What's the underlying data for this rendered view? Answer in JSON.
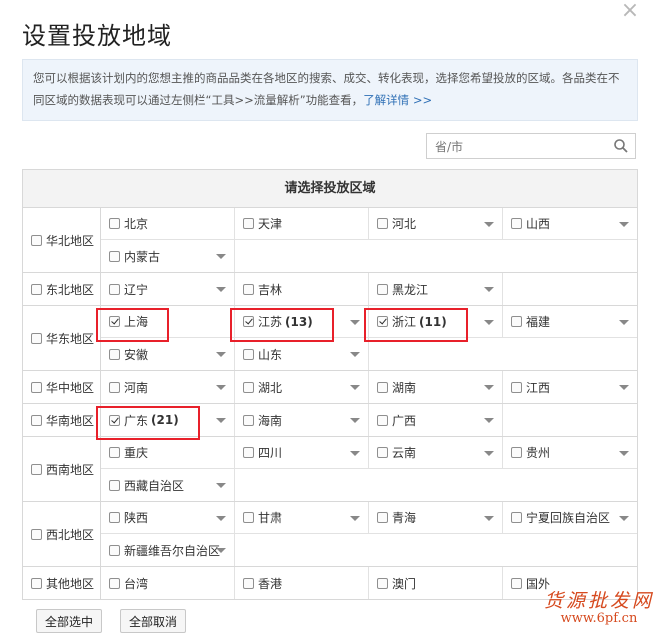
{
  "dialog": {
    "title": "设置投放地域",
    "close": "×",
    "info_text": "您可以根据该计划内的您想主推的商品品类在各地区的搜索、成交、转化表现，选择您希望投放的区域。各品类在不同区域的数据表现可以通过左侧栏“工具>>流量解析”功能查看，",
    "info_link": "了解详情 >>",
    "search_placeholder": "省/市",
    "grid_header": "请选择投放区域",
    "select_all": "全部选中",
    "deselect_all": "全部取消",
    "watermark_line1": "货源批发网",
    "watermark_line2": "www.6pf.cn"
  },
  "regions": [
    {
      "name": "华北地区",
      "checked": false,
      "provinces": [
        {
          "name": "北京",
          "checked": false,
          "count": "",
          "dropdown": false
        },
        {
          "name": "天津",
          "checked": false,
          "count": "",
          "dropdown": false
        },
        {
          "name": "河北",
          "checked": false,
          "count": "",
          "dropdown": true
        },
        {
          "name": "山西",
          "checked": false,
          "count": "",
          "dropdown": true
        },
        {
          "name": "内蒙古",
          "checked": false,
          "count": "",
          "dropdown": true
        }
      ]
    },
    {
      "name": "东北地区",
      "checked": false,
      "provinces": [
        {
          "name": "辽宁",
          "checked": false,
          "count": "",
          "dropdown": true
        },
        {
          "name": "吉林",
          "checked": false,
          "count": "",
          "dropdown": false
        },
        {
          "name": "黑龙江",
          "checked": false,
          "count": "",
          "dropdown": true
        }
      ]
    },
    {
      "name": "华东地区",
      "checked": false,
      "provinces": [
        {
          "name": "上海",
          "checked": true,
          "count": "",
          "dropdown": false
        },
        {
          "name": "江苏",
          "checked": true,
          "count": "(13)",
          "dropdown": true
        },
        {
          "name": "浙江",
          "checked": true,
          "count": "(11)",
          "dropdown": true
        },
        {
          "name": "福建",
          "checked": false,
          "count": "",
          "dropdown": true
        },
        {
          "name": "安徽",
          "checked": false,
          "count": "",
          "dropdown": true
        },
        {
          "name": "山东",
          "checked": false,
          "count": "",
          "dropdown": true
        }
      ]
    },
    {
      "name": "华中地区",
      "checked": false,
      "provinces": [
        {
          "name": "河南",
          "checked": false,
          "count": "",
          "dropdown": true
        },
        {
          "name": "湖北",
          "checked": false,
          "count": "",
          "dropdown": true
        },
        {
          "name": "湖南",
          "checked": false,
          "count": "",
          "dropdown": true
        },
        {
          "name": "江西",
          "checked": false,
          "count": "",
          "dropdown": true
        }
      ]
    },
    {
      "name": "华南地区",
      "checked": false,
      "provinces": [
        {
          "name": "广东",
          "checked": true,
          "count": "(21)",
          "dropdown": true
        },
        {
          "name": "海南",
          "checked": false,
          "count": "",
          "dropdown": true
        },
        {
          "name": "广西",
          "checked": false,
          "count": "",
          "dropdown": true
        }
      ]
    },
    {
      "name": "西南地区",
      "checked": false,
      "provinces": [
        {
          "name": "重庆",
          "checked": false,
          "count": "",
          "dropdown": false
        },
        {
          "name": "四川",
          "checked": false,
          "count": "",
          "dropdown": true
        },
        {
          "name": "云南",
          "checked": false,
          "count": "",
          "dropdown": true
        },
        {
          "name": "贵州",
          "checked": false,
          "count": "",
          "dropdown": true
        },
        {
          "name": "西藏自治区",
          "checked": false,
          "count": "",
          "dropdown": true
        }
      ]
    },
    {
      "name": "西北地区",
      "checked": false,
      "provinces": [
        {
          "name": "陕西",
          "checked": false,
          "count": "",
          "dropdown": true
        },
        {
          "name": "甘肃",
          "checked": false,
          "count": "",
          "dropdown": true
        },
        {
          "name": "青海",
          "checked": false,
          "count": "",
          "dropdown": true
        },
        {
          "name": "宁夏回族自治区",
          "checked": false,
          "count": "",
          "dropdown": true
        },
        {
          "name": "新疆维吾尔自治区",
          "checked": false,
          "count": "",
          "dropdown": true
        }
      ]
    },
    {
      "name": "其他地区",
      "checked": false,
      "provinces": [
        {
          "name": "台湾",
          "checked": false,
          "count": "",
          "dropdown": false
        },
        {
          "name": "香港",
          "checked": false,
          "count": "",
          "dropdown": false
        },
        {
          "name": "澳门",
          "checked": false,
          "count": "",
          "dropdown": false
        },
        {
          "name": "国外",
          "checked": false,
          "count": "",
          "dropdown": false
        }
      ]
    }
  ],
  "highlighted": [
    "上海",
    "江苏",
    "浙江",
    "广东"
  ],
  "colors": {
    "highlight": "#e8202a",
    "link": "#2e6fb5",
    "info_bg": "#eef4fb"
  }
}
